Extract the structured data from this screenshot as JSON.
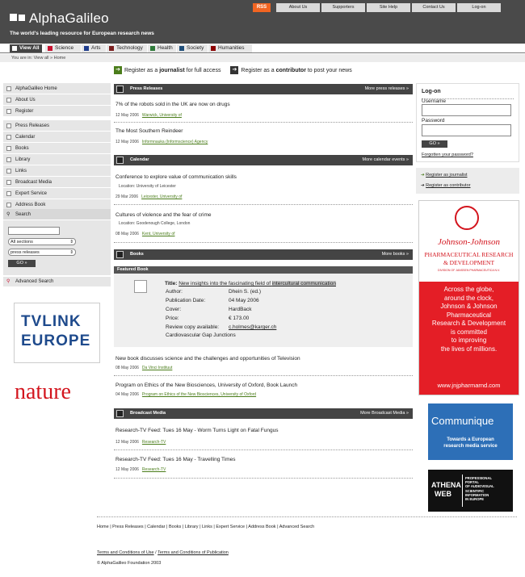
{
  "header": {
    "title": "AlphaGalileo",
    "tagline": "The world's leading resource for European research news",
    "rss": "RSS",
    "topnav": [
      "About Us",
      "Supporters",
      "Site Help",
      "Contact Us",
      "Log-on"
    ]
  },
  "categories": [
    {
      "label": "View All",
      "color": "#ffffff"
    },
    {
      "label": "Science",
      "color": "#c8102e"
    },
    {
      "label": "Arts",
      "color": "#1e3c8c"
    },
    {
      "label": "Technology",
      "color": "#7a1e1e"
    },
    {
      "label": "Health",
      "color": "#2f7a3a"
    },
    {
      "label": "Society",
      "color": "#1f4e79"
    },
    {
      "label": "Humanities",
      "color": "#8b0000"
    }
  ],
  "breadcrumb": "You are in: View all » Home",
  "register": {
    "journalist_pre": "Register as a ",
    "journalist_b": "journalist",
    "journalist_post": " for full access",
    "contributor_pre": "Register as a ",
    "contributor_b": "contributor",
    "contributor_post": " to post your news"
  },
  "leftnav": {
    "group1": [
      "AlphaGalileo Home",
      "About Us",
      "Register"
    ],
    "group2": [
      "Press Releases",
      "Calendar",
      "Books",
      "Library",
      "Links",
      "Broadcast Media",
      "Expert Service",
      "Address Book"
    ],
    "search_label": "Search",
    "search_value": "",
    "section_select": "All sections",
    "type_select": "press releases",
    "go": "GO  »",
    "advanced": "Advanced Search"
  },
  "logos": {
    "tvlink1": "TVLINK",
    "tvlink2": "EUROPE",
    "nature": "nature"
  },
  "press": {
    "header": "Press Releases",
    "more": "More press releases »",
    "items": [
      {
        "title": "7% of the robots sold in the UK are now on drugs",
        "date": "12 May 2006",
        "source": "Warwick, University of"
      },
      {
        "title": "The Most Southern Reindeer",
        "date": "12 May 2006",
        "source": "Informnauka (Informscience) Agency"
      }
    ]
  },
  "calendar": {
    "header": "Calendar",
    "more": "More calendar events »",
    "items": [
      {
        "title": "Conference to explore value of communication skills",
        "location": "Location: University of Leicester",
        "date": "29 Mar 2006",
        "source": "Leicester, University of"
      },
      {
        "title": "Cultures of violence and the fear of crime",
        "location": "Location: Goodenough College, London",
        "date": "08 May 2006",
        "source": "Kent, University of"
      }
    ]
  },
  "books": {
    "header": "Books",
    "more": "More books »",
    "featured_label": "Featured Book",
    "title_label": "Title:",
    "title_pre": "New insights into the fascinating field of ",
    "title_hl": "intercultural communication",
    "rows": [
      {
        "k": "Author:",
        "v": "Dhein S. (ed.)"
      },
      {
        "k": "Publication Date:",
        "v": "04 May 2006"
      },
      {
        "k": "Cover:",
        "v": "HardBack"
      },
      {
        "k": "Price:",
        "v": "€ 173.00"
      },
      {
        "k": "Review copy available:",
        "v": "c.holmes@karger.ch"
      }
    ],
    "extra": "Cardiovascular Gap Junctions",
    "items": [
      {
        "title": "New book discusses science and the challenges and opportunities of Television",
        "date": "08 May 2006",
        "source": "Da Vinci Instituut"
      },
      {
        "title": "Program on Ethics of the New Biosciences, University of Oxford, Book Launch",
        "date": "04 May 2006",
        "source": "Program on Ethics of the New Biosciences, University of Oxford"
      }
    ]
  },
  "broadcast": {
    "header": "Broadcast Media",
    "more": "More Broadcast Media »",
    "items": [
      {
        "title": "Research-TV Feed: Tues 16 May - Worm Turns Light on Fatal Fungus",
        "date": "12 May 2006",
        "source": "Research-TV"
      },
      {
        "title": "Research-TV Feed: Tues 16 May - Travelling Times",
        "date": "12 May 2006",
        "source": "Research-TV"
      }
    ]
  },
  "logon": {
    "title": "Log-on",
    "username": "Username",
    "password": "Password",
    "go": "GO  »",
    "forgotten": "Forgotten your password?",
    "reg_journalist": "Register as journalist",
    "reg_contributor": "Register as contributor"
  },
  "ads": {
    "jj_name": "Johnson-Johnson",
    "jj_sub1": "PHARMACEUTICAL RESEARCH",
    "jj_sub2": "& DEVELOPMENT",
    "jj_div": "DIVISION OF JANSSEN PHARMACEUTICA N.V.",
    "jj_body": [
      "Across the globe,",
      "around the clock,",
      "Johnson & Johnson",
      "Pharmaceutical",
      "Research & Development",
      "is committed",
      "to improving",
      "the lives of millions."
    ],
    "jj_url": "www.jnjpharmarnd.com",
    "comm_title": "Communique",
    "comm_sub1": "Towards a European",
    "comm_sub2": "research media service",
    "athena1": "ATHENA",
    "athena2": "WEB",
    "athena_desc": [
      "PROFESSIONAL",
      "PORTAL",
      "OF AUDIOVISUAL",
      "SCIENTIFIC",
      "INFORMATION",
      "IN EUROPE"
    ]
  },
  "footer": {
    "links": "Home | Press Releases | Calendar | Books | Library | Links | Expert Service | Address Book | Advanced Search",
    "terms": "Terms and Conditions of Use",
    "sep": " / ",
    "terms_pub": "Terms and Conditions of Publication",
    "copy": "© AlphaGalileo Foundation 2003"
  }
}
